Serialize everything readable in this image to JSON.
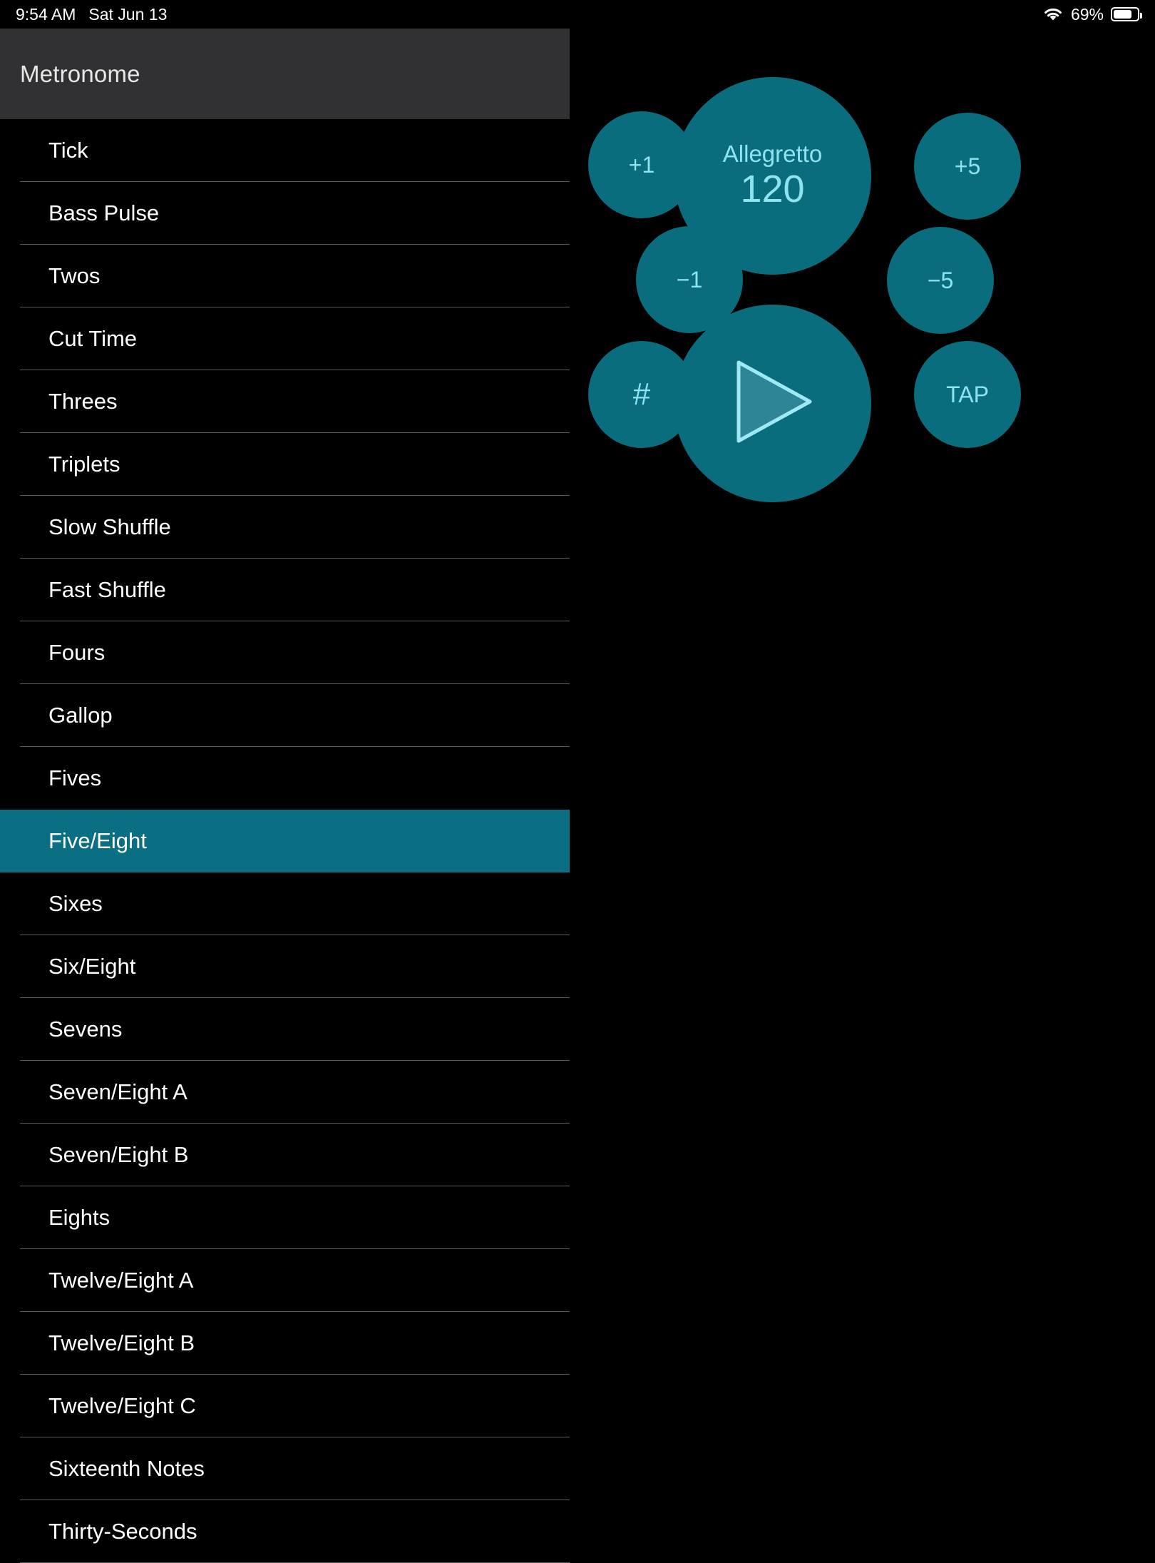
{
  "status_bar": {
    "time": "9:54 AM",
    "date": "Sat Jun 13",
    "wifi_icon": "wifi-icon",
    "battery_percent": "69%",
    "battery_level": 69,
    "battery_icon": "battery-icon"
  },
  "sidebar": {
    "title": "Metronome",
    "selected_index": 11,
    "items": [
      {
        "label": "Tick"
      },
      {
        "label": "Bass Pulse"
      },
      {
        "label": "Twos"
      },
      {
        "label": "Cut Time"
      },
      {
        "label": "Threes"
      },
      {
        "label": "Triplets"
      },
      {
        "label": "Slow Shuffle"
      },
      {
        "label": "Fast Shuffle"
      },
      {
        "label": "Fours"
      },
      {
        "label": "Gallop"
      },
      {
        "label": "Fives"
      },
      {
        "label": "Five/Eight"
      },
      {
        "label": "Sixes"
      },
      {
        "label": "Six/Eight"
      },
      {
        "label": "Sevens"
      },
      {
        "label": "Seven/Eight A"
      },
      {
        "label": "Seven/Eight B"
      },
      {
        "label": "Eights"
      },
      {
        "label": "Twelve/Eight A"
      },
      {
        "label": "Twelve/Eight B"
      },
      {
        "label": "Twelve/Eight C"
      },
      {
        "label": "Sixteenth Notes"
      },
      {
        "label": "Thirty-Seconds"
      }
    ]
  },
  "metronome": {
    "tempo_name": "Allegretto",
    "tempo_bpm": "120",
    "increment_one": "+1",
    "increment_five": "+5",
    "decrement_one": "−1",
    "decrement_five": "−5",
    "subdivision_label": "#",
    "tap_label": "TAP",
    "play_icon": "play-icon"
  },
  "colors": {
    "accent_teal": "#0a6d7d",
    "selection_teal": "#0b6f83",
    "accent_text": "#8fe3ef",
    "header_gray": "#313133",
    "background": "#000000",
    "separator": "#5a5a5a"
  }
}
